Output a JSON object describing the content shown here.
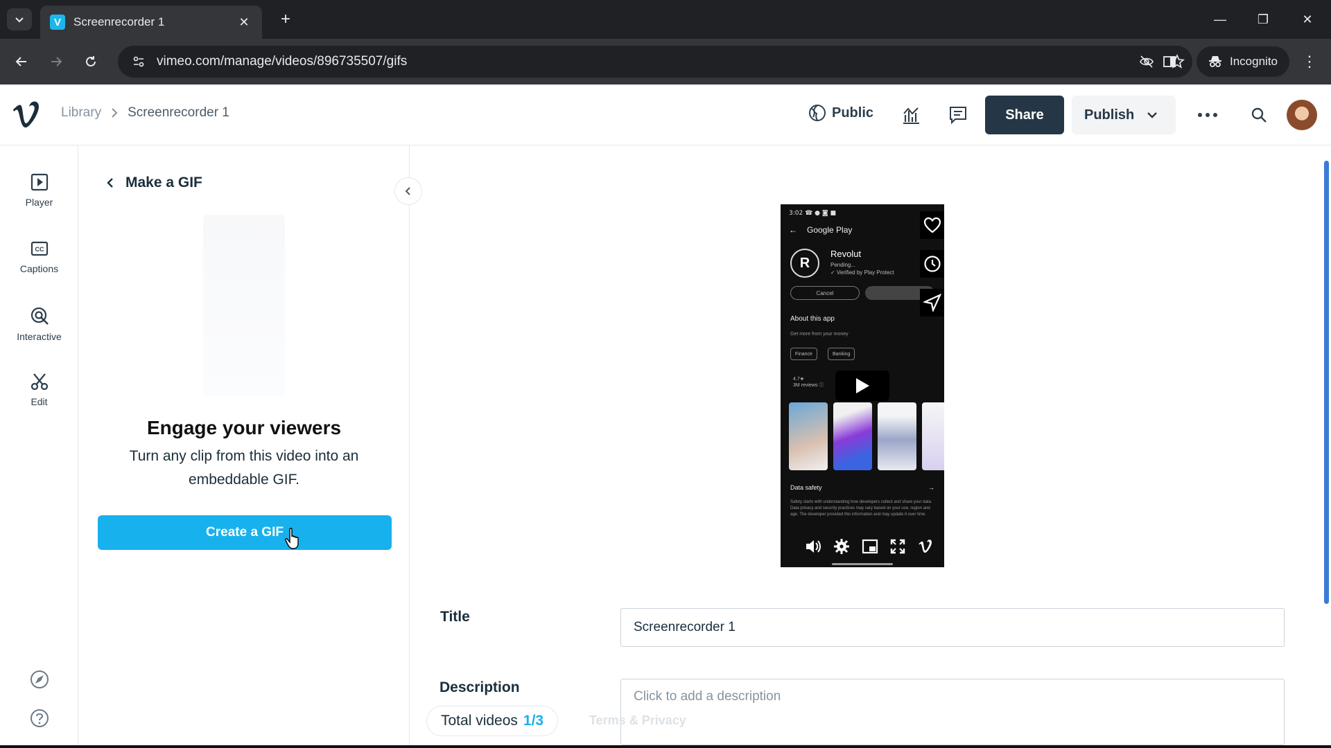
{
  "browser": {
    "tab_title": "Screenrecorder 1",
    "url": "vimeo.com/manage/videos/896735507/gifs",
    "incognito_label": "Incognito"
  },
  "header": {
    "breadcrumb": [
      "Library",
      "Screenrecorder 1"
    ],
    "privacy_label": "Public",
    "share_label": "Share",
    "publish_label": "Publish"
  },
  "rail": {
    "items": [
      {
        "label": "Player",
        "icon": "play-square-icon"
      },
      {
        "label": "Captions",
        "icon": "cc-icon"
      },
      {
        "label": "Interactive",
        "icon": "interactive-icon"
      },
      {
        "label": "Edit",
        "icon": "scissors-icon"
      }
    ]
  },
  "gif_panel": {
    "heading": "Make a GIF",
    "title": "Engage your viewers",
    "description": "Turn any clip from this video into an embeddable GIF.",
    "button_label": "Create a GIF"
  },
  "video_screen": {
    "status": "3:02 ☎ ● ◙ ■",
    "store": "Google Play",
    "app_initial": "R",
    "app_name": "Revolut",
    "app_status": "Pending...",
    "app_verified": "✓ Verified by Play Protect",
    "cancel_label": "Cancel",
    "about": "About this app",
    "about_sub": "Get more from your money",
    "chips": [
      "Finance",
      "Banking"
    ],
    "rating": "4.7★",
    "reviews": "3M reviews ⓘ",
    "safety": "Data safety",
    "safety_text": "Safety starts with understanding how developers collect and share your data. Data privacy and security practices may vary based on your use, region and age. The developer provided this information and may update it over time."
  },
  "form": {
    "title_label": "Title",
    "title_value": "Screenrecorder 1",
    "description_label": "Description",
    "description_placeholder": "Click to add a description"
  },
  "footer": {
    "total_label": "Total videos",
    "total_count": "1/3",
    "terms": "Terms & Privacy"
  },
  "colors": {
    "accent": "#17b1ee",
    "dark_button": "#253746",
    "browser_dark": "#202124"
  }
}
